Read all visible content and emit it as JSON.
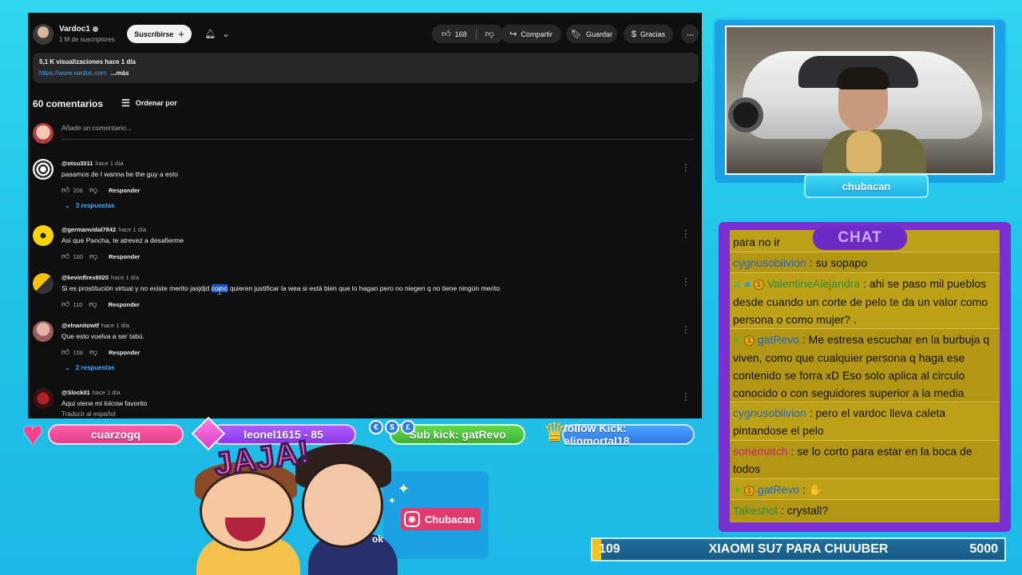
{
  "youtube": {
    "channel_name": "Vardoc1",
    "subscribers": "1 M de suscriptores",
    "subscribe_label": "Suscribirse",
    "likes": "168",
    "share_label": "Compartir",
    "save_label": "Guardar",
    "thanks_label": "Gracias",
    "description": {
      "views": "5,1 K visualizaciones  hace 1 día",
      "link": "https://www.vardoc.com",
      "more": "...más"
    },
    "comments_count": "60 comentarios",
    "sort_label": "Ordenar por",
    "add_comment_placeholder": "Añade un comentario...",
    "comments": [
      {
        "user": "@otsu3011",
        "time": "hace 1 día",
        "text": "pasamos de I wanna be the guy a esto",
        "likes": "206",
        "reply": "Responder",
        "replies": "3 respuestas"
      },
      {
        "user": "@germanvidal7842",
        "time": "hace 1 día",
        "text": "Asi que Pancha, te atrevez a desafierme",
        "likes": "160",
        "reply": "Responder"
      },
      {
        "user": "@kevinflres6020",
        "time": "hace 1 día",
        "text_before": "Si es prostitución virtual y no existe merito jasjdjd ",
        "text_highlight": "como",
        "text_after": " quieren justificar la wea si está bien que lo hagan pero no niegen q no tiene ningún merito",
        "likes": "110",
        "reply": "Responder"
      },
      {
        "user": "@elnanitowtf",
        "time": "hace 1 día",
        "text": "Que esto vuelva a ser tabú.",
        "likes": "158",
        "reply": "Responder",
        "replies": "2 respuestas"
      },
      {
        "user": "@Slock01",
        "time": "hace 1 día",
        "text": "Aqui viene mi lolcow favorito",
        "translate": "Traducir al español"
      }
    ]
  },
  "webcam": {
    "streamer_name": "chubacan"
  },
  "chat": {
    "title": "CHAT",
    "messages": [
      {
        "text": "para no ir"
      },
      {
        "user": "cygnusoblivion",
        "text": " : su sopapo"
      },
      {
        "user": "ValentineAlejandra",
        "text": " : ahi se paso mil pueblos desde cuando un corte de pelo te da un valor como persona o como mujer? ."
      },
      {
        "user": "gatRevo",
        "text": " : Me estresa escuchar en la burbuja q viven, como que cualquier persona q haga ese contenido se forra xD Eso solo aplica al circulo conocido o con seguidores superior a la media"
      },
      {
        "user": "cygnusoblivion",
        "text": " : pero el vardoc lleva caleta pintandose el pelo"
      },
      {
        "user": "sonematch",
        "text": " : se lo corto para estar en la boca de todos"
      },
      {
        "user": "gatRevo",
        "text": " : "
      },
      {
        "user": "Takeshot",
        "text": " : crystall?"
      }
    ]
  },
  "alerts": {
    "follower": "cuarzogq",
    "gift": "leonel1615 - 85",
    "sub": "Sub kick: gatRevo",
    "follow": "follow Kick: elinmortal18"
  },
  "sticker": {
    "jaja": "JAJA!",
    "instagram": "Chubacan",
    "fragment": "ok"
  },
  "goal": {
    "current": "109",
    "title": "XIAOMI SU7 PARA CHUUBER",
    "target": "5000",
    "progress": 0.0218
  },
  "colors": {
    "chat_bg": "#bba018",
    "chat_frame": "#7a2fd2",
    "accent_cyan": "#22c4e8"
  }
}
